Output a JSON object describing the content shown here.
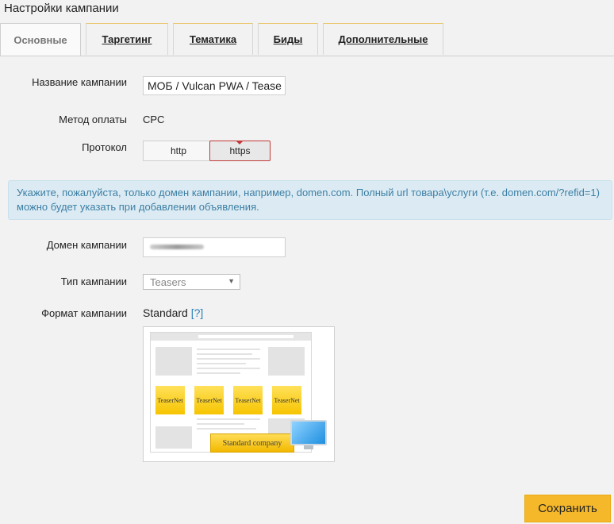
{
  "page": {
    "title": "Настройки кампании"
  },
  "tabs": [
    {
      "label": "Основные",
      "active": true
    },
    {
      "label": "Таргетинг",
      "active": false
    },
    {
      "label": "Тематика",
      "active": false
    },
    {
      "label": "Биды",
      "active": false
    },
    {
      "label": "Дополнительные",
      "active": false
    }
  ],
  "form": {
    "campaign_name": {
      "label": "Название кампании",
      "value": "МОБ / Vulcan PWA / Tease"
    },
    "payment": {
      "label": "Метод оплаты",
      "value": "CPC"
    },
    "protocol": {
      "label": "Протокол",
      "options": [
        "http",
        "https"
      ],
      "selected": "https"
    },
    "info_text": "Укажите, пожалуйста, только домен кампании, например, domen.com. Полный url товара\\услуги (т.е. domen.com/?refid=1) можно будет указать при добавлении объявления.",
    "domain": {
      "label": "Домен кампании",
      "value": ""
    },
    "type": {
      "label": "Тип кампании",
      "selected": "Teasers"
    },
    "format": {
      "label": "Формат кампании",
      "value": "Standard",
      "help": "[?]"
    }
  },
  "preview": {
    "teaser_label": "TeaserNet",
    "badge": "Standard company"
  },
  "actions": {
    "save": "Сохранить"
  },
  "colors": {
    "accent": "#f5b82a",
    "info_bg": "#dcebf3",
    "info_text": "#3d7fa5",
    "link": "#2a7fb8"
  }
}
